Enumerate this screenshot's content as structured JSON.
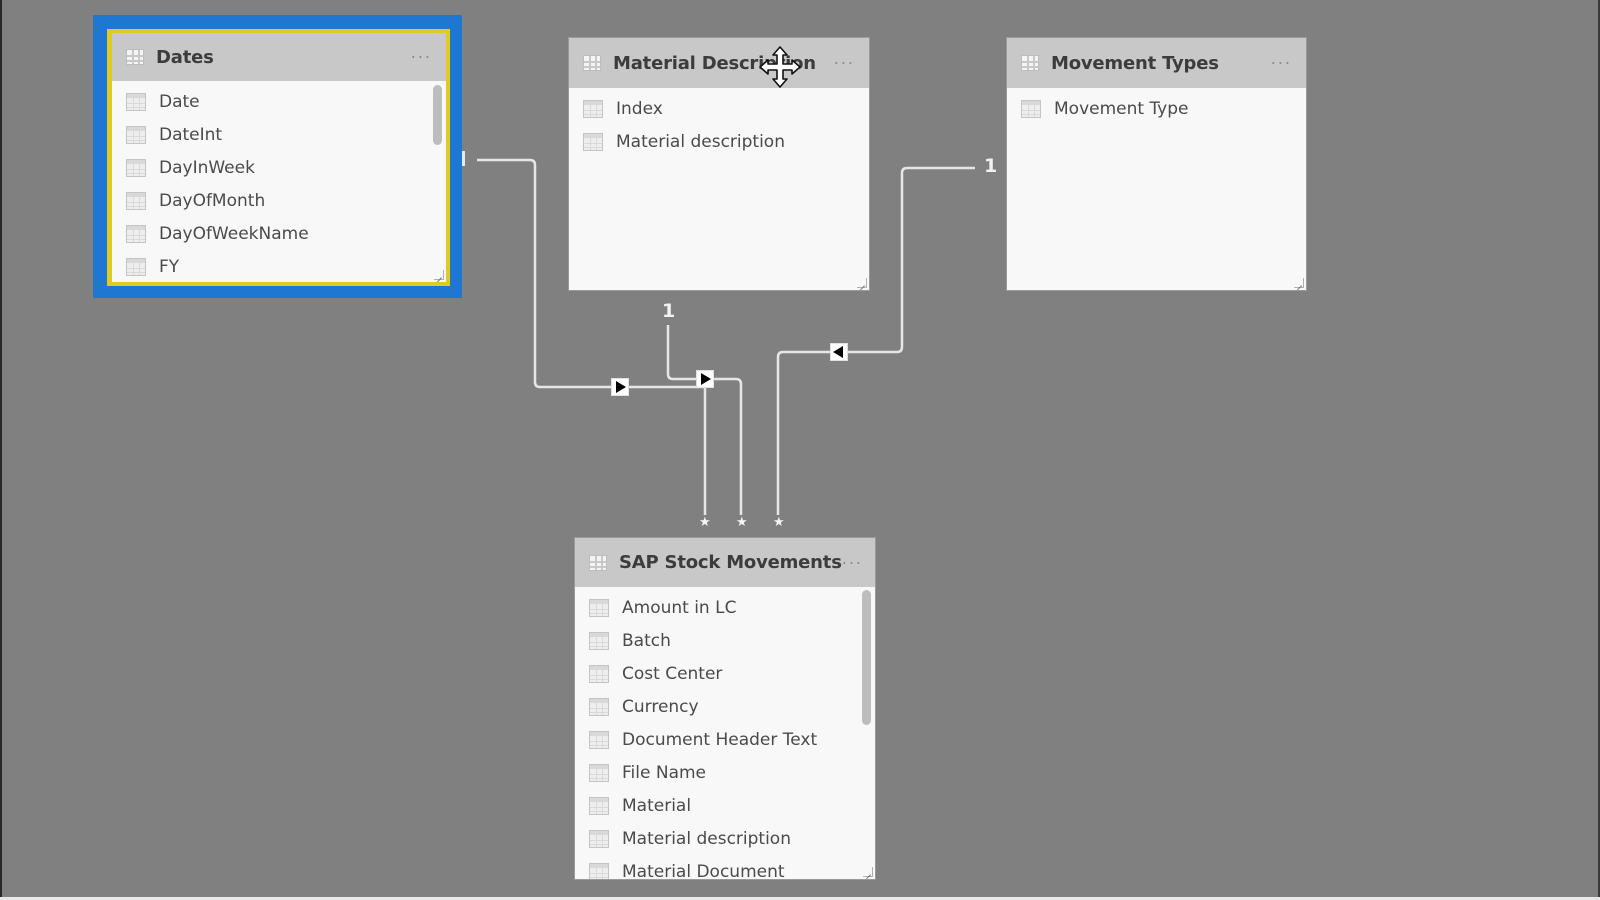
{
  "tables": {
    "dates": {
      "title": "Dates",
      "more": "···",
      "selected": true,
      "fields": [
        "Date",
        "DateInt",
        "DayInWeek",
        "DayOfMonth",
        "DayOfWeekName",
        "FY"
      ]
    },
    "material_description": {
      "title": "Material Description",
      "more": "···",
      "fields": [
        "Index",
        "Material description"
      ]
    },
    "movement_types": {
      "title": "Movement Types",
      "more": "···",
      "fields": [
        "Movement Type"
      ]
    },
    "sap_stock_movements": {
      "title": "SAP Stock Movements",
      "more": "···",
      "fields": [
        "Amount in LC",
        "Batch",
        "Cost Center",
        "Currency",
        "Document Header Text",
        "File Name",
        "Material",
        "Material description",
        "Material Document"
      ]
    }
  },
  "relationships": [
    {
      "from": "Dates",
      "to": "SAP Stock Movements",
      "from_cardinality": "1",
      "to_cardinality": "*",
      "filter_direction": "right-arrow-icon"
    },
    {
      "from": "Material Description",
      "to": "SAP Stock Movements",
      "from_cardinality": "1",
      "to_cardinality": "*",
      "filter_direction": "right-arrow-icon"
    },
    {
      "from": "Movement Types",
      "to": "SAP Stock Movements",
      "from_cardinality": "1",
      "to_cardinality": "*",
      "filter_direction": "left-arrow-icon"
    }
  ],
  "labels": {
    "one": "1",
    "many": "*"
  },
  "colors": {
    "canvas": "#808080",
    "selection_outer": "#1e78d2",
    "selection_inner": "#e0cc1e",
    "header": "#c8c8c8"
  },
  "cursor": "move-cursor-icon"
}
